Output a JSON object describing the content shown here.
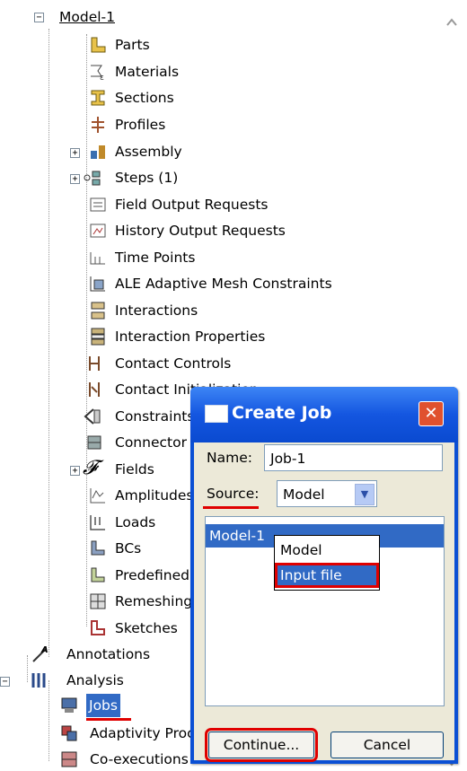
{
  "tree": {
    "root": "Model-1",
    "items": [
      {
        "label": "Parts",
        "icon": "parts-icon"
      },
      {
        "label": "Materials",
        "icon": "materials-icon"
      },
      {
        "label": "Sections",
        "icon": "sections-icon"
      },
      {
        "label": "Profiles",
        "icon": "profiles-icon"
      },
      {
        "label": "Assembly",
        "icon": "assembly-icon"
      },
      {
        "label": "Steps (1)",
        "icon": "steps-icon"
      },
      {
        "label": "Field Output Requests",
        "icon": "field-output-icon"
      },
      {
        "label": "History Output Requests",
        "icon": "history-output-icon"
      },
      {
        "label": "Time Points",
        "icon": "time-points-icon"
      },
      {
        "label": "ALE Adaptive Mesh Constraints",
        "icon": "ale-mesh-icon"
      },
      {
        "label": "Interactions",
        "icon": "interactions-icon"
      },
      {
        "label": "Interaction Properties",
        "icon": "interaction-properties-icon"
      },
      {
        "label": "Contact Controls",
        "icon": "contact-controls-icon"
      },
      {
        "label": "Contact Initialization",
        "icon": "contact-init-icon"
      },
      {
        "label": "Constraints",
        "icon": "constraints-icon"
      },
      {
        "label": "Connector Sections",
        "icon": "connector-icon"
      },
      {
        "label": "Fields",
        "icon": "fields-icon"
      },
      {
        "label": "Amplitudes",
        "icon": "amplitudes-icon"
      },
      {
        "label": "Loads",
        "icon": "loads-icon"
      },
      {
        "label": "BCs",
        "icon": "bcs-icon"
      },
      {
        "label": "Predefined Fields",
        "icon": "predefined-icon"
      },
      {
        "label": "Remeshing Rules",
        "icon": "remeshing-icon"
      },
      {
        "label": "Sketches",
        "icon": "sketches-icon"
      }
    ],
    "annotations": "Annotations",
    "analysis": "Analysis",
    "jobs": "Jobs",
    "adaptivity": "Adaptivity Processes",
    "coexecution": "Co-executions"
  },
  "dialog": {
    "title": "Create Job",
    "name_label": "Name:",
    "name_value": "Job-1",
    "source_label": "Source:",
    "source_value": "Model",
    "list_items": [
      "Model-1"
    ],
    "dropdown_options": [
      "Model",
      "Input file"
    ],
    "continue_label": "Continue...",
    "cancel_label": "Cancel",
    "close_symbol": "✕"
  },
  "colors": {
    "selection": "#316ac5",
    "highlight": "#e00000",
    "titlebar": "#0a4fd4"
  }
}
